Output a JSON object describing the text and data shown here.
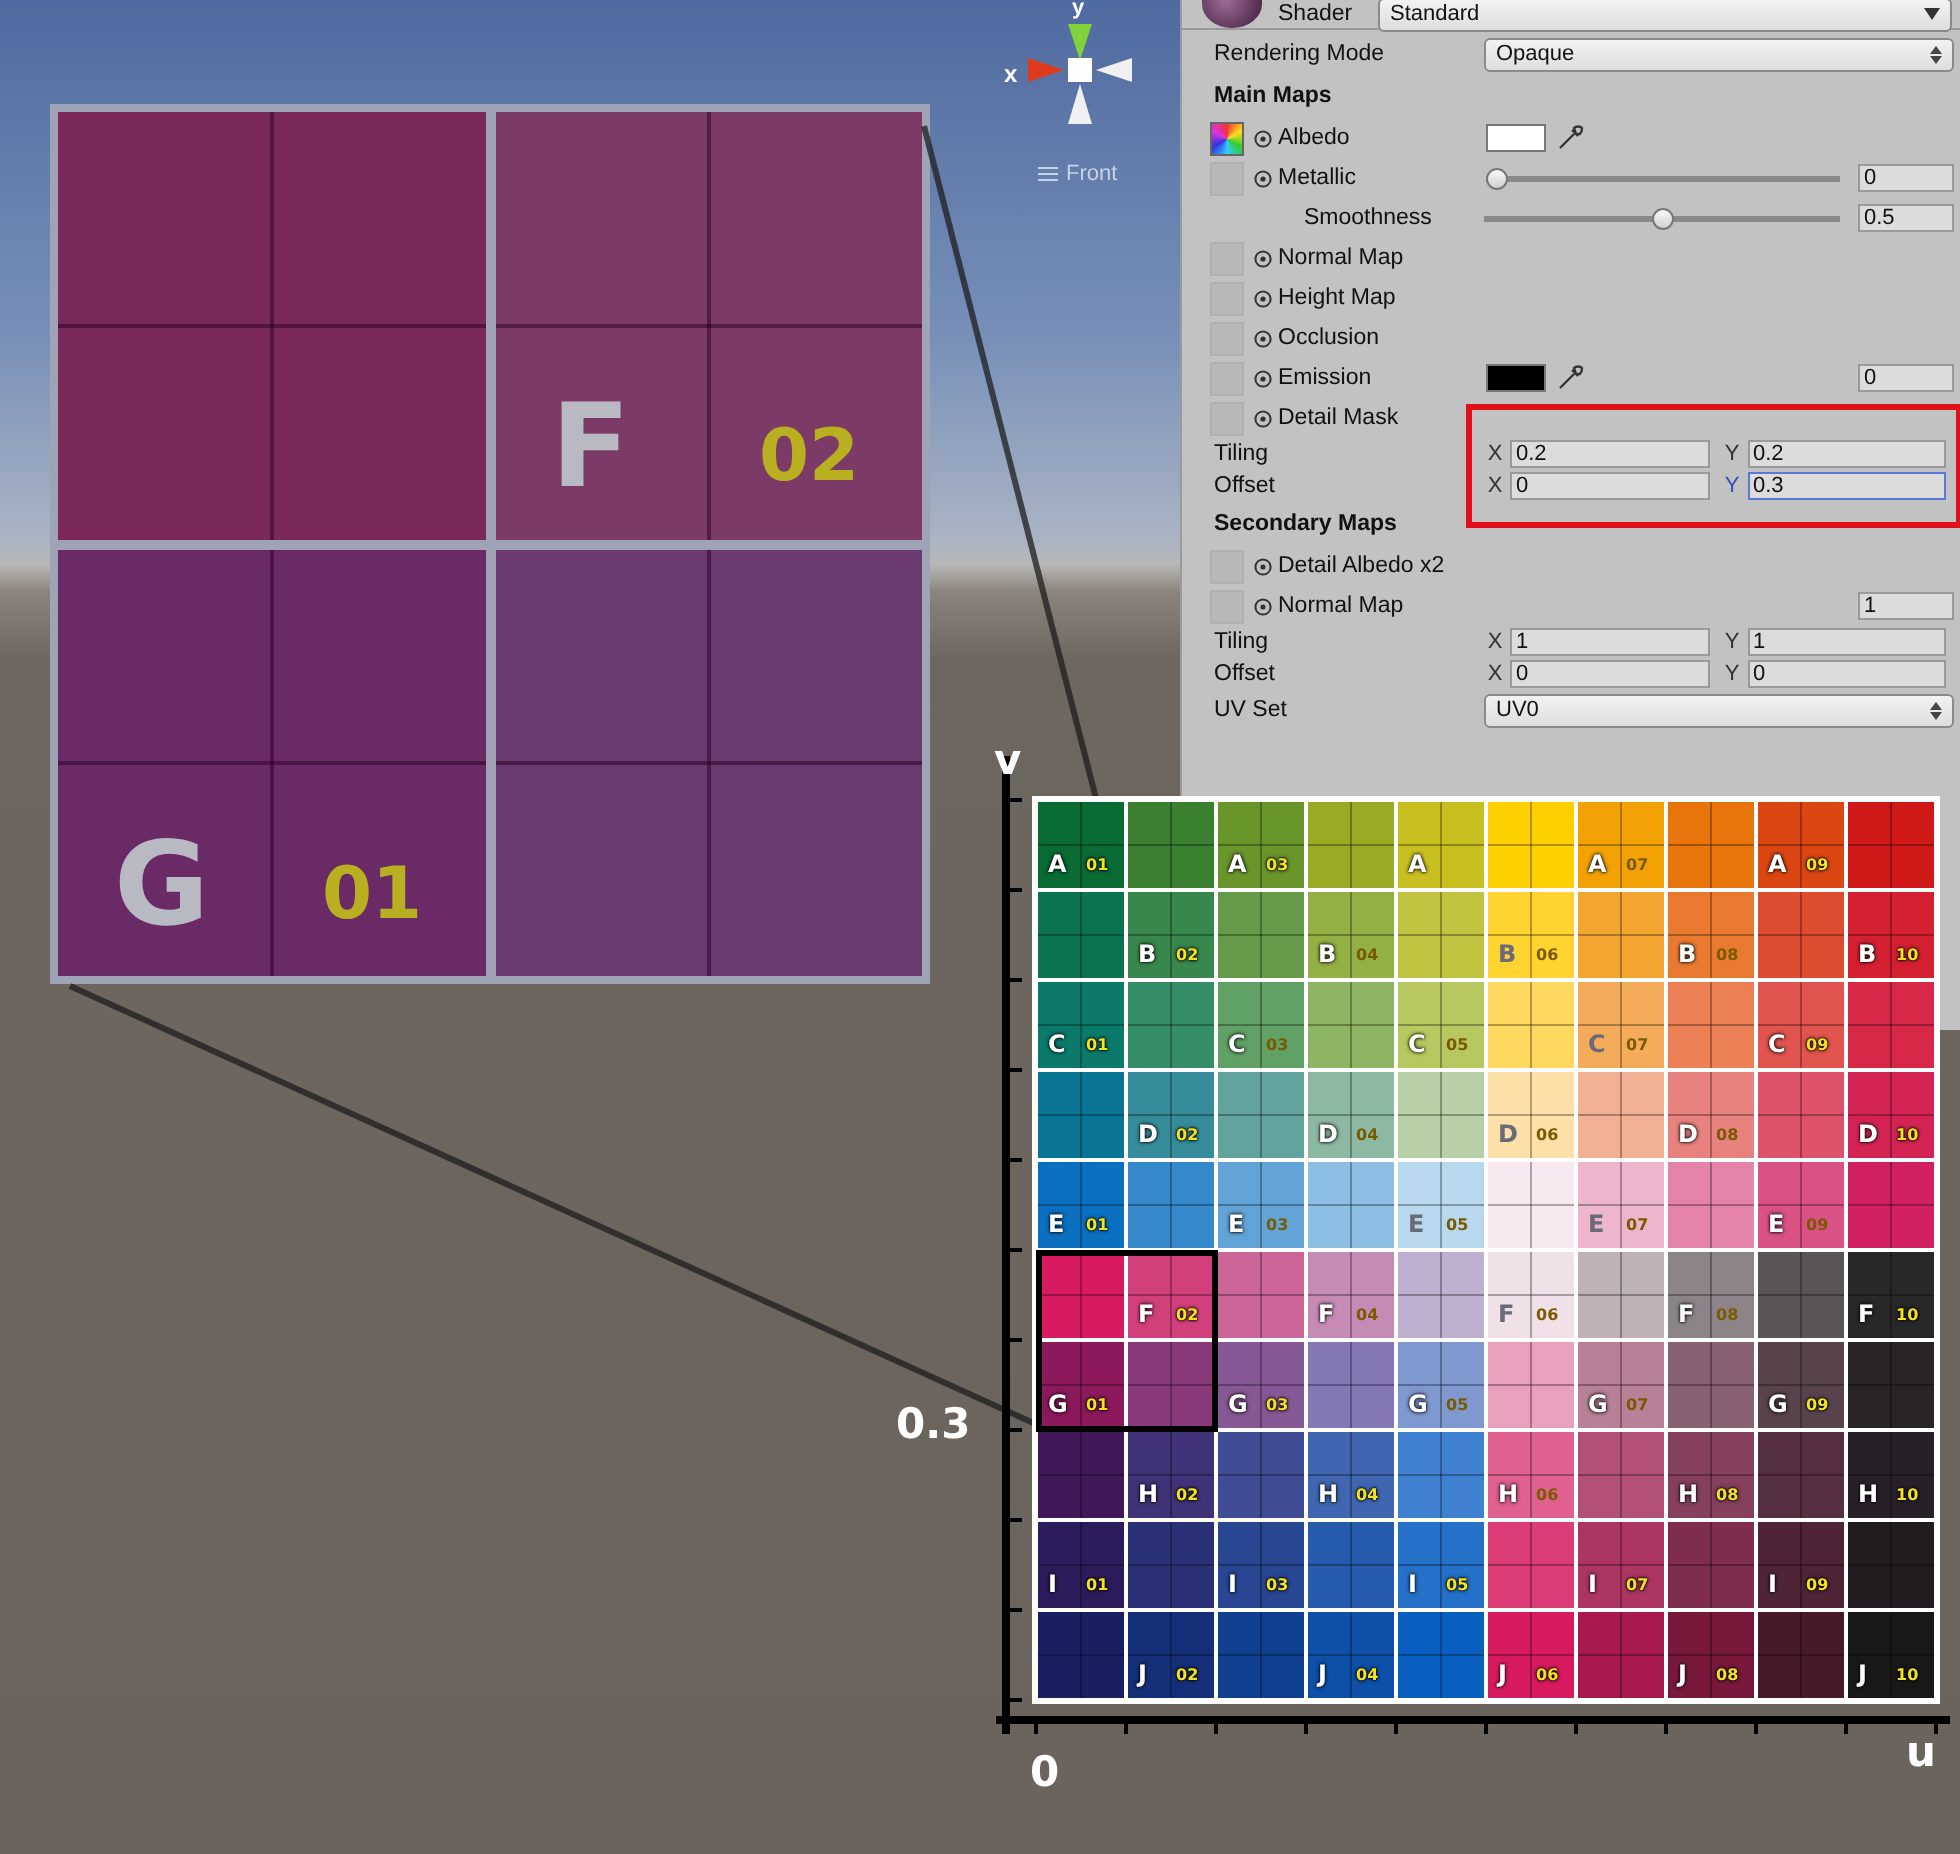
{
  "scene": {
    "gizmo": {
      "x_axis": "x",
      "y_axis": "y",
      "view": "Front"
    }
  },
  "inspector": {
    "shader": {
      "label": "Shader",
      "value": "Standard"
    },
    "rows": [
      {
        "kind": "dropdown",
        "label": "Rendering Mode",
        "value": "Opaque"
      },
      {
        "kind": "heading",
        "label": "Main Maps"
      },
      {
        "kind": "texture",
        "label": "Albedo",
        "has_texture": true,
        "color": "#ffffff"
      },
      {
        "kind": "texture",
        "label": "Metallic",
        "has_texture": false,
        "level": 0,
        "value": "0"
      },
      {
        "kind": "slider",
        "label": "Smoothness",
        "level": 0.5,
        "value": "0.5"
      },
      {
        "kind": "texture",
        "label": "Normal Map",
        "has_texture": false
      },
      {
        "kind": "texture",
        "label": "Height Map",
        "has_texture": false
      },
      {
        "kind": "texture",
        "label": "Occlusion",
        "has_texture": false
      },
      {
        "kind": "texture",
        "label": "Emission",
        "has_texture": false,
        "color": "#000000",
        "value": "0"
      },
      {
        "kind": "texture",
        "label": "Detail Mask",
        "has_texture": false
      },
      {
        "kind": "vector",
        "label": "Tiling",
        "highlighted": true,
        "fields": [
          {
            "axis": "X",
            "value": "0.2",
            "focused": false
          },
          {
            "axis": "Y",
            "value": "0.2",
            "focused": false
          }
        ]
      },
      {
        "kind": "vector",
        "label": "Offset",
        "highlighted": true,
        "fields": [
          {
            "axis": "X",
            "value": "0",
            "focused": false
          },
          {
            "axis": "Y",
            "value": "0.3",
            "focused": true
          }
        ]
      },
      {
        "kind": "heading",
        "label": "Secondary Maps"
      },
      {
        "kind": "texture",
        "label": "Detail Albedo x2",
        "has_texture": false
      },
      {
        "kind": "texture",
        "label": "Normal Map",
        "has_texture": false,
        "value": "1"
      },
      {
        "kind": "vector",
        "label": "Tiling",
        "highlighted": false,
        "fields": [
          {
            "axis": "X",
            "value": "1",
            "focused": false
          },
          {
            "axis": "Y",
            "value": "1",
            "focused": false
          }
        ]
      },
      {
        "kind": "vector",
        "label": "Offset",
        "highlighted": false,
        "fields": [
          {
            "axis": "X",
            "value": "0",
            "focused": false
          },
          {
            "axis": "Y",
            "value": "0",
            "focused": false
          }
        ]
      },
      {
        "kind": "dropdown",
        "label": "UV Set",
        "value": "UV0"
      }
    ]
  },
  "zoom_view": {
    "rows": [
      {
        "labels": [
          {
            "letter": "F",
            "number": "02"
          }
        ]
      },
      {
        "labels": [
          {
            "letter": "G",
            "number": "01"
          }
        ]
      }
    ]
  },
  "uv_diagram": {
    "v_label": "v",
    "u_label": "u",
    "origin_label": "0",
    "offset_label": "0.3",
    "rows": [
      {
        "labels": [
          {
            "letter": "A",
            "number": "01"
          },
          {
            "letter": "A",
            "number": "03"
          },
          {
            "letter": "A"
          },
          {
            "letter": "A",
            "number": "07"
          },
          {
            "letter": "A",
            "number": "09"
          }
        ]
      },
      {
        "labels": [
          {
            "letter": "B",
            "number": "02"
          },
          {
            "letter": "B",
            "number": "04"
          },
          {
            "letter": "B",
            "number": "06"
          },
          {
            "letter": "B",
            "number": "08"
          },
          {
            "letter": "B",
            "number": "10"
          }
        ]
      },
      {
        "labels": [
          {
            "letter": "C",
            "number": "01"
          },
          {
            "letter": "C",
            "number": "03"
          },
          {
            "letter": "C",
            "number": "05"
          },
          {
            "letter": "C",
            "number": "07"
          },
          {
            "letter": "C",
            "number": "09"
          }
        ]
      },
      {
        "labels": [
          {
            "letter": "D",
            "number": "02"
          },
          {
            "letter": "D",
            "number": "04"
          },
          {
            "letter": "D",
            "number": "06"
          },
          {
            "letter": "D",
            "number": "08"
          },
          {
            "letter": "D",
            "number": "10"
          }
        ]
      },
      {
        "labels": [
          {
            "letter": "E",
            "number": "01"
          },
          {
            "letter": "E",
            "number": "03"
          },
          {
            "letter": "E",
            "number": "05"
          },
          {
            "letter": "E",
            "number": "07"
          },
          {
            "letter": "E",
            "number": "09"
          }
        ]
      },
      {
        "labels": [
          {
            "letter": "F",
            "number": "02"
          },
          {
            "letter": "F",
            "number": "04"
          },
          {
            "letter": "F",
            "number": "06"
          },
          {
            "letter": "F",
            "number": "08"
          },
          {
            "letter": "F",
            "number": "10"
          }
        ]
      },
      {
        "labels": [
          {
            "letter": "G",
            "number": "01"
          },
          {
            "letter": "G",
            "number": "03"
          },
          {
            "letter": "G",
            "number": "05"
          },
          {
            "letter": "G",
            "number": "07"
          },
          {
            "letter": "G",
            "number": "09"
          }
        ]
      },
      {
        "labels": [
          {
            "letter": "H",
            "number": "02"
          },
          {
            "letter": "H",
            "number": "04"
          },
          {
            "letter": "H",
            "number": "06"
          },
          {
            "letter": "H",
            "number": "08"
          },
          {
            "letter": "H",
            "number": "10"
          }
        ]
      },
      {
        "labels": [
          {
            "letter": "I",
            "number": "01"
          },
          {
            "letter": "I",
            "number": "03"
          },
          {
            "letter": "I",
            "number": "05"
          },
          {
            "letter": "I",
            "number": "07"
          },
          {
            "letter": "I",
            "number": "09"
          }
        ]
      },
      {
        "labels": [
          {
            "letter": "J",
            "number": "02"
          },
          {
            "letter": "J",
            "number": "04"
          },
          {
            "letter": "J",
            "number": "06"
          },
          {
            "letter": "J",
            "number": "08"
          },
          {
            "letter": "J",
            "number": "10"
          }
        ]
      }
    ]
  }
}
